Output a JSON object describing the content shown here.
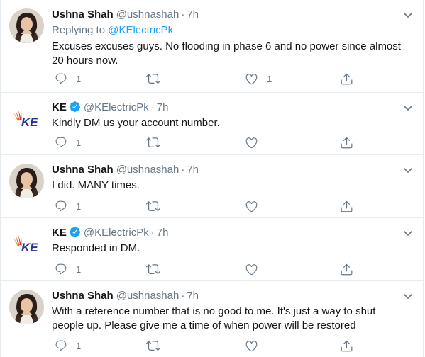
{
  "tweets": [
    {
      "author": "Ushna Shah",
      "handle": "@ushnashah",
      "dot": "·",
      "time": "7h",
      "verified": false,
      "replying_prefix": "Replying to",
      "replying_to": "@KElectricPk",
      "text": "Excuses excuses guys. No flooding in phase 6 and no power since almost 20 hours now.",
      "reply_count": "1",
      "retweet_count": "",
      "like_count": "1"
    },
    {
      "author": "KE",
      "handle": "@KElectricPk",
      "dot": "·",
      "time": "7h",
      "verified": true,
      "text": "Kindly DM us your account number.",
      "reply_count": "1",
      "retweet_count": "",
      "like_count": ""
    },
    {
      "author": "Ushna Shah",
      "handle": "@ushnashah",
      "dot": "·",
      "time": "7h",
      "verified": false,
      "text": "I did. MANY times.",
      "reply_count": "1",
      "retweet_count": "",
      "like_count": ""
    },
    {
      "author": "KE",
      "handle": "@KElectricPk",
      "dot": "·",
      "time": "7h",
      "verified": true,
      "text": "Responded in DM.",
      "reply_count": "1",
      "retweet_count": "",
      "like_count": ""
    },
    {
      "author": "Ushna Shah",
      "handle": "@ushnashah",
      "dot": "·",
      "time": "7h",
      "verified": false,
      "text": "With a reference number that is no good to me. It's just a way to shut people up. Please give me a time of when power will be restored",
      "reply_count": "1",
      "retweet_count": "",
      "like_count": ""
    }
  ],
  "logo_text": "KE",
  "colors": {
    "link": "#1da1f2",
    "secondary": "#657786",
    "verified": "#1da1f2",
    "icon": "#657786",
    "ke_red": "#e0313a",
    "ke_orange": "#f7931e",
    "ke_blue": "#2e3192"
  },
  "icons": {
    "reply": "reply-icon",
    "retweet": "retweet-icon",
    "like": "heart-icon",
    "share": "share-icon",
    "menu": "chevron-down-icon",
    "verified": "verified-badge-icon"
  }
}
